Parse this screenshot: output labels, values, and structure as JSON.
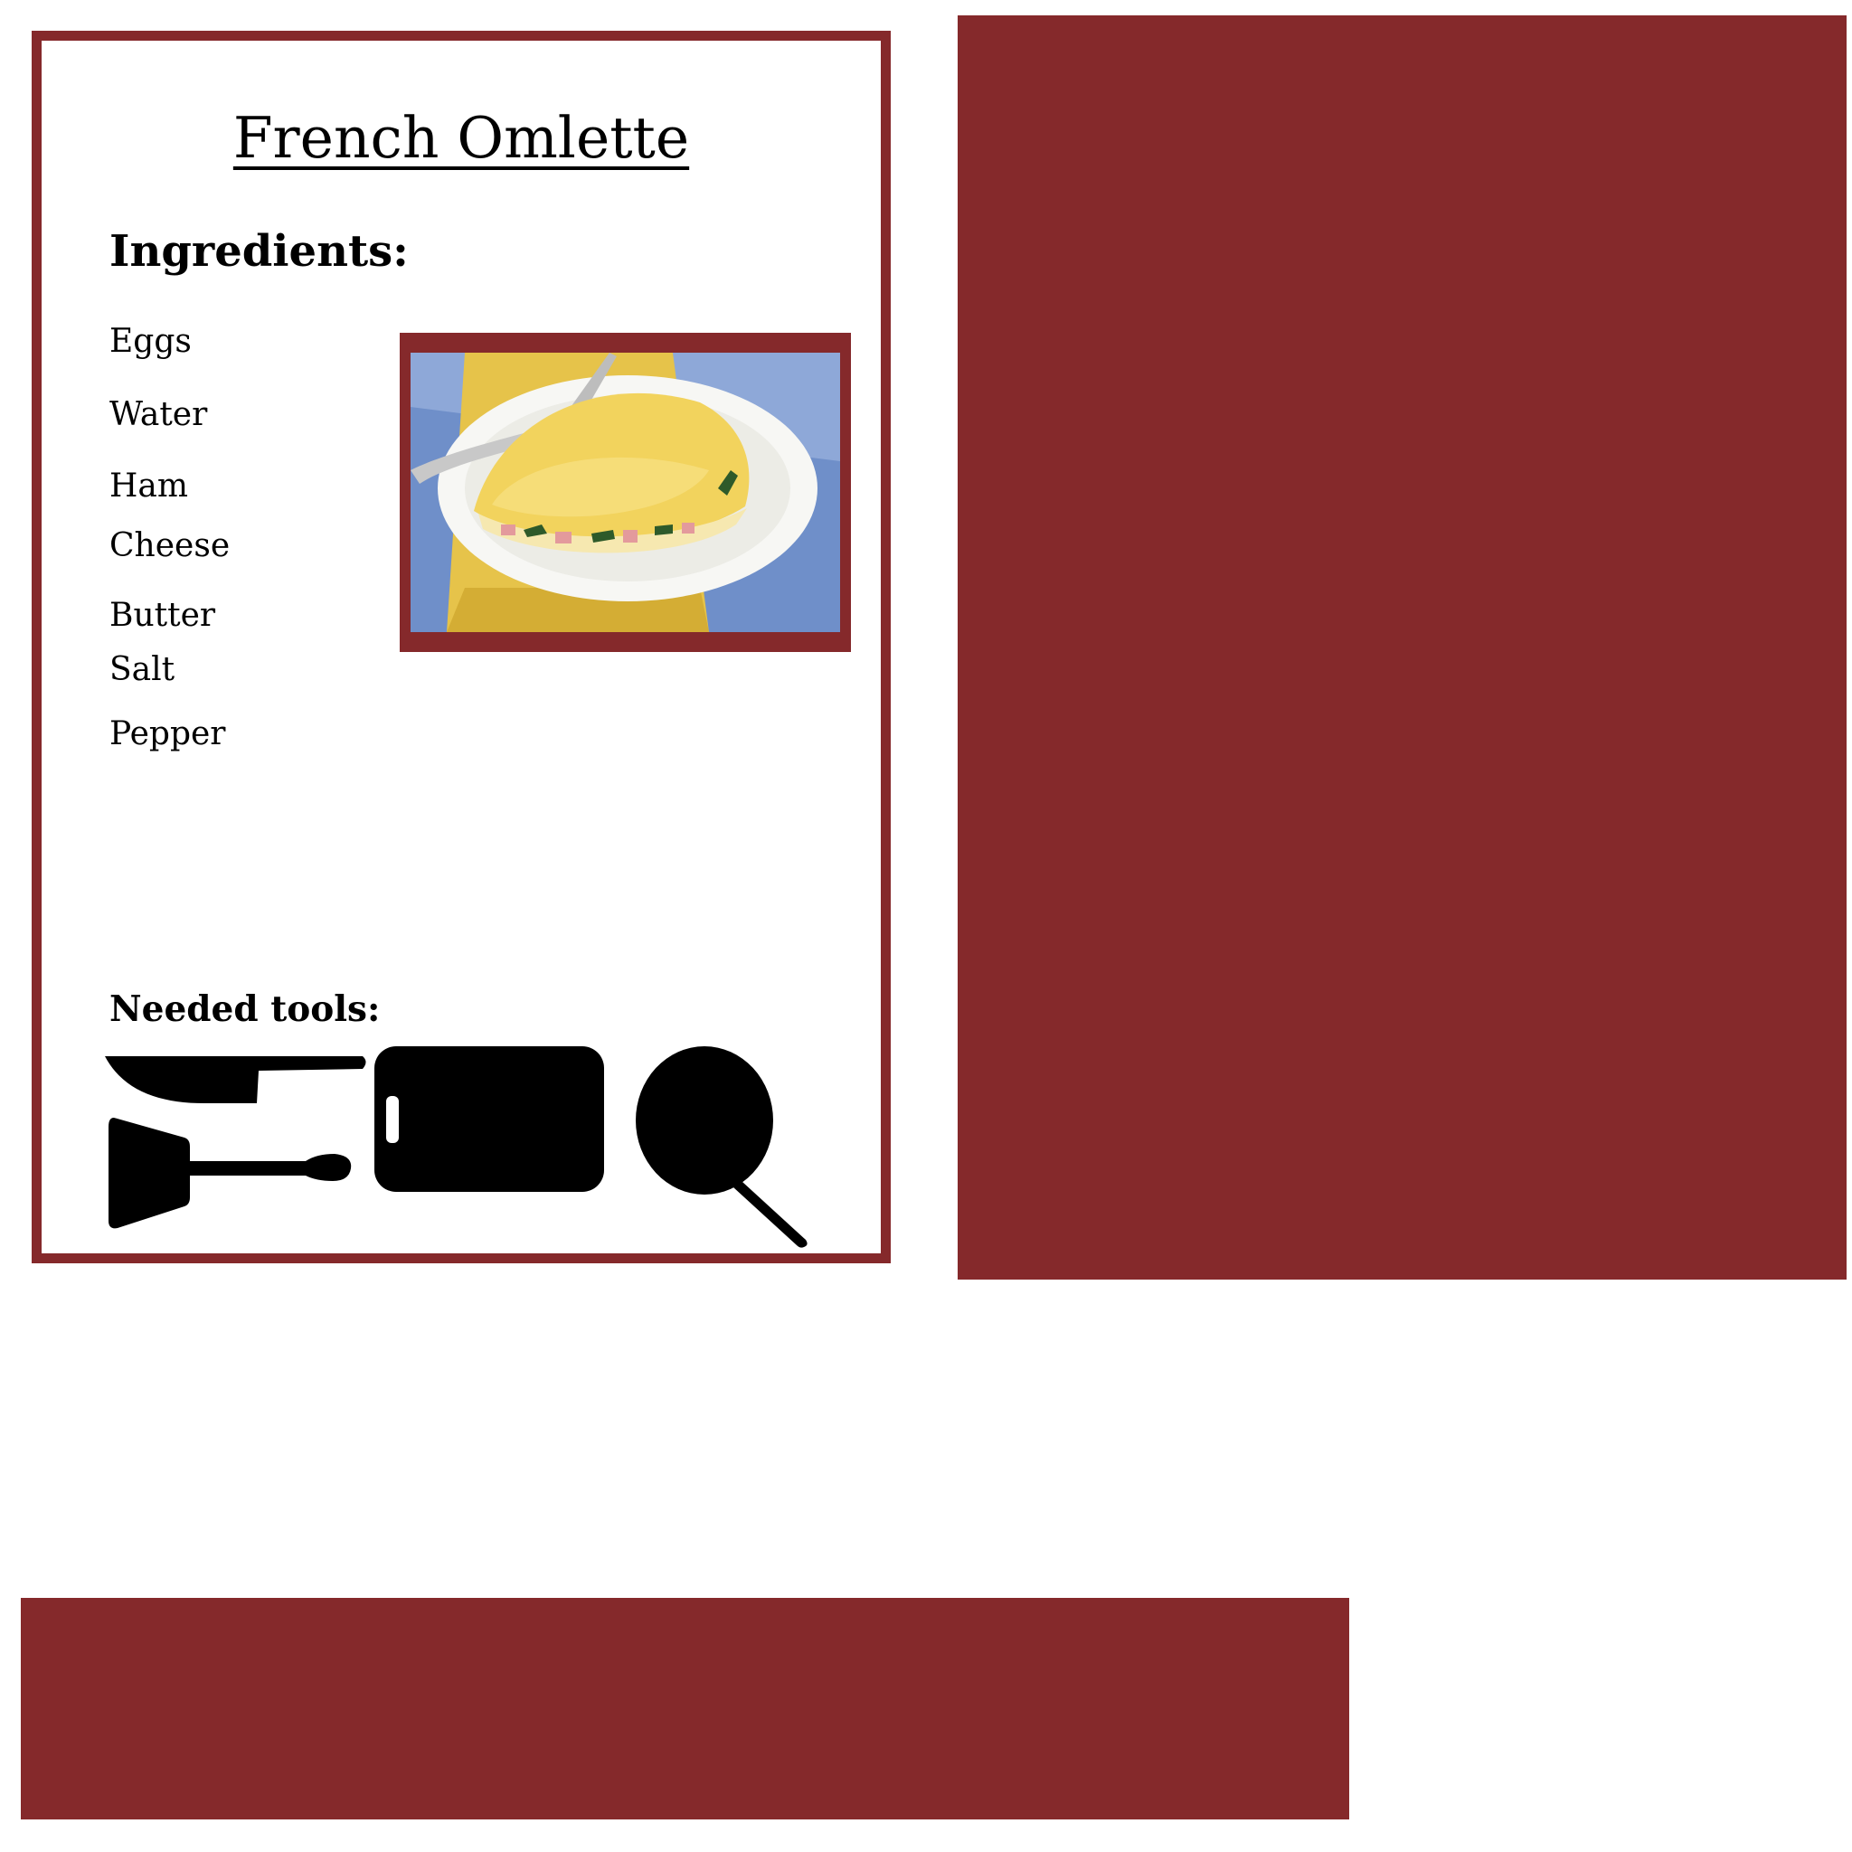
{
  "recipe": {
    "title": "French Omlette",
    "ingredients_heading": "Ingredients:",
    "ingredients": [
      "Eggs",
      "Water",
      "Ham",
      "Cheese",
      "Butter",
      "Salt",
      "Pepper"
    ],
    "tools_heading": "Needed tools:",
    "tools": [
      "knife-icon",
      "spatula-icon",
      "cutting-board-icon",
      "frying-pan-icon"
    ],
    "photo": "omelette-photo"
  },
  "colors": {
    "accent": "#85292b",
    "text": "#000000",
    "background": "#ffffff"
  }
}
